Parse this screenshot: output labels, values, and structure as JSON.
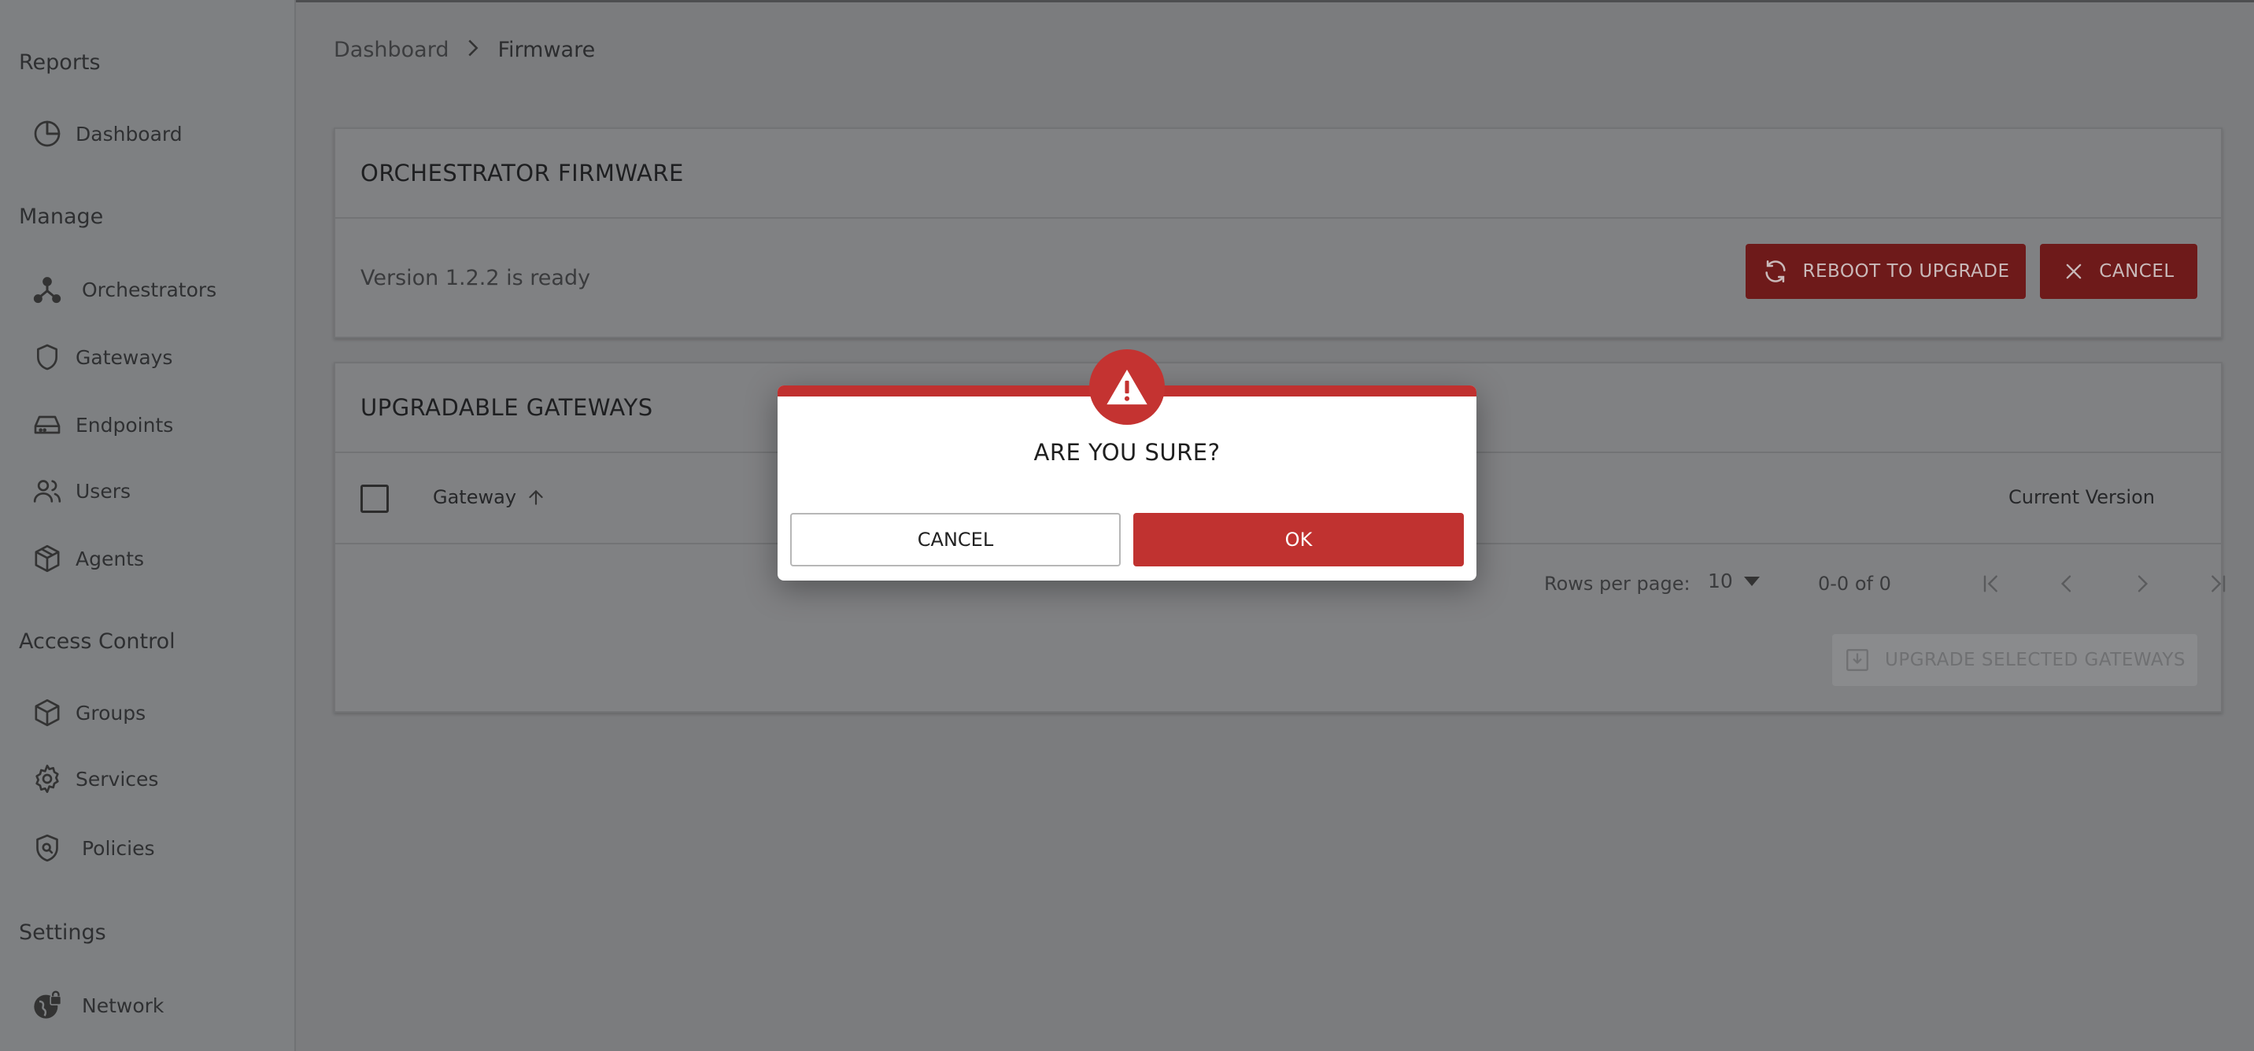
{
  "sidebar": {
    "sections": {
      "reports": "Reports",
      "manage": "Manage",
      "access_control": "Access Control",
      "settings": "Settings"
    },
    "items": {
      "dashboard": {
        "label": "Dashboard",
        "icon": "pie-chart-icon"
      },
      "orchestrators": {
        "label": "Orchestrators",
        "icon": "hub-icon"
      },
      "gateways": {
        "label": "Gateways",
        "icon": "shield-icon"
      },
      "endpoints": {
        "label": "Endpoints",
        "icon": "hard-drive-icon"
      },
      "users": {
        "label": "Users",
        "icon": "users-icon"
      },
      "agents": {
        "label": "Agents",
        "icon": "package-icon"
      },
      "groups": {
        "label": "Groups",
        "icon": "box-icon"
      },
      "services": {
        "label": "Services",
        "icon": "gear-icon"
      },
      "policies": {
        "label": "Policies",
        "icon": "shield-search-icon"
      },
      "network": {
        "label": "Network",
        "icon": "globe-lock-icon"
      }
    }
  },
  "breadcrumb": {
    "parent": "Dashboard",
    "current": "Firmware"
  },
  "firmware_card": {
    "title": "ORCHESTRATOR FIRMWARE",
    "status": "Version 1.2.2 is ready",
    "reboot_label": "REBOOT TO UPGRADE",
    "cancel_label": "CANCEL"
  },
  "gateways_card": {
    "title": "UPGRADABLE GATEWAYS",
    "columns": {
      "gateway": "Gateway",
      "current_version": "Current Version"
    },
    "pagination": {
      "rows_per_page_label": "Rows per page:",
      "rows_per_page_value": "10",
      "range": "0-0 of 0"
    },
    "upgrade_label": "UPGRADE SELECTED GATEWAYS"
  },
  "dialog": {
    "title": "ARE YOU SURE?",
    "cancel_label": "CANCEL",
    "ok_label": "OK"
  },
  "colors": {
    "accent_red": "#c03230",
    "dark_red": "#6e1a1a",
    "overlay_gray": "#7b7c7e"
  }
}
